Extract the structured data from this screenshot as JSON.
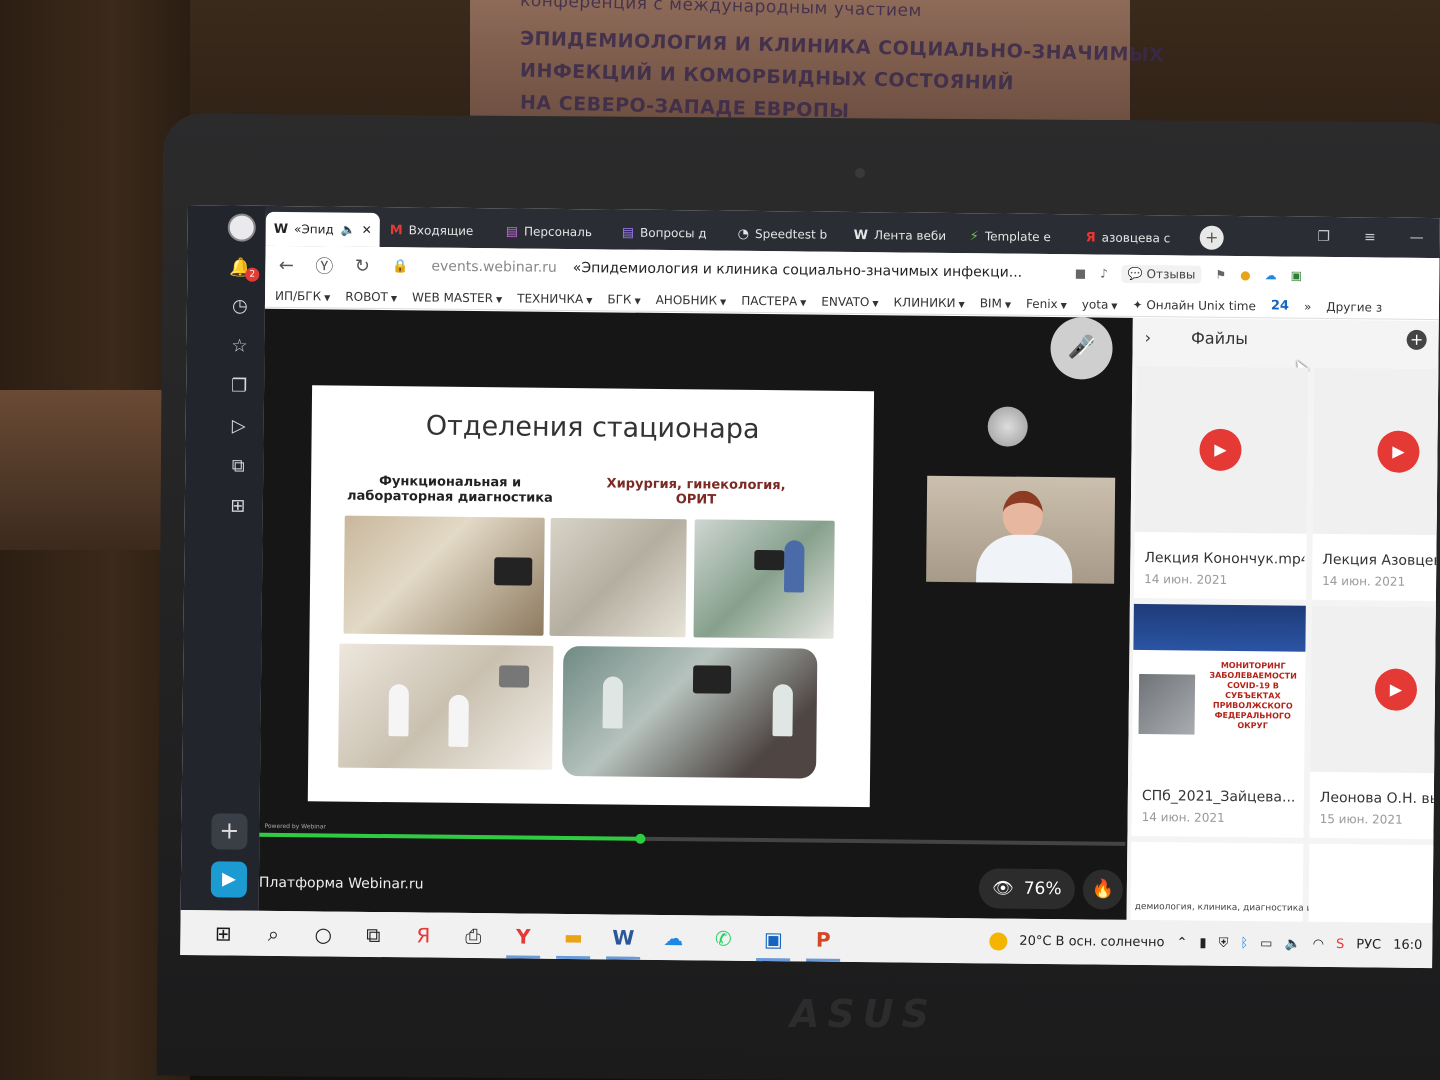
{
  "banner": {
    "line0": "конференция с международным участием",
    "line1": "ЭПИДЕМИОЛОГИЯ И КЛИНИКА СОЦИАЛЬНО-ЗНАЧИМЫХ",
    "line2": "ИНФЕКЦИЙ И КОМОРБИДНЫХ СОСТОЯНИЙ",
    "line3": "НА СЕВЕРО-ЗАПАДЕ ЕВРОПЫ"
  },
  "laptop_brand": "ASUS",
  "browser": {
    "notifications_count": "2",
    "tabs": [
      {
        "icon": "W",
        "label": "«Эпид",
        "active": true
      },
      {
        "icon": "M",
        "label": "Входящие"
      },
      {
        "icon": "▤",
        "label": "Персональ"
      },
      {
        "icon": "▤",
        "label": "Вопросы д"
      },
      {
        "icon": "◔",
        "label": "Speedtest b"
      },
      {
        "icon": "W",
        "label": "Лента веби"
      },
      {
        "icon": "⚡",
        "label": "Template e"
      },
      {
        "icon": "Я",
        "label": "азовцева с"
      }
    ],
    "address": {
      "domain": "events.webinar.ru",
      "title": "«Эпидемиология и клиника социально-значимых инфекци...",
      "reviews_label": "Отзывы"
    },
    "bookmarks": [
      "ИП/БГК",
      "ROBOT",
      "WEB MASTER",
      "ТЕХНИЧКА",
      "БГК",
      "АНОБНИК",
      "ПАСТЕРА",
      "ENVATO",
      "КЛИНИКИ",
      "BIM",
      "Fenix",
      "yota"
    ],
    "bookmark_unix": "Онлайн Unix time",
    "bookmark_count": "24",
    "bookmark_more": "»",
    "bookmark_others": "Другие з"
  },
  "slide": {
    "title": "Отделения стационара",
    "col_a": "Функциональная и лабораторная диагностика",
    "col_b": "Хирургия, гинекология, ОРИТ"
  },
  "stage": {
    "powered_by": "Powered by Webinar",
    "progress_percent": 44,
    "platform_label": "Платформа Webinar.ru",
    "viewers_percent": "76%"
  },
  "files_panel": {
    "title": "Файлы",
    "items": [
      {
        "name": "Лекция Конончук.mp4",
        "date": "14 июн. 2021",
        "type": "video"
      },
      {
        "name": "Лекция Азовцева",
        "date": "14 июн. 2021",
        "type": "video"
      },
      {
        "name": "СПб_2021_Зайцева...",
        "date": "14 июн. 2021",
        "type": "document",
        "thumb_text": "МОНИТОРИНГ ЗАБОЛЕВАЕМОСТИ COVID-19 В СУБЪЕКТАХ ПРИВОЛЖСКОГО ФЕДЕРАЛЬНОГО ОКРУГ"
      },
      {
        "name": "Леонова О.Н. вь",
        "date": "15 июн. 2021",
        "type": "video"
      }
    ],
    "partial_text": "демиология, клиника, диагностика и ле"
  },
  "taskbar": {
    "weather": "20°C  В осн. солнечно",
    "language": "РУС",
    "time": "16:0"
  },
  "colors": {
    "accent_red": "#e53935",
    "progress_green": "#2ecc40",
    "slide_subtitle": "#7b2a24"
  }
}
